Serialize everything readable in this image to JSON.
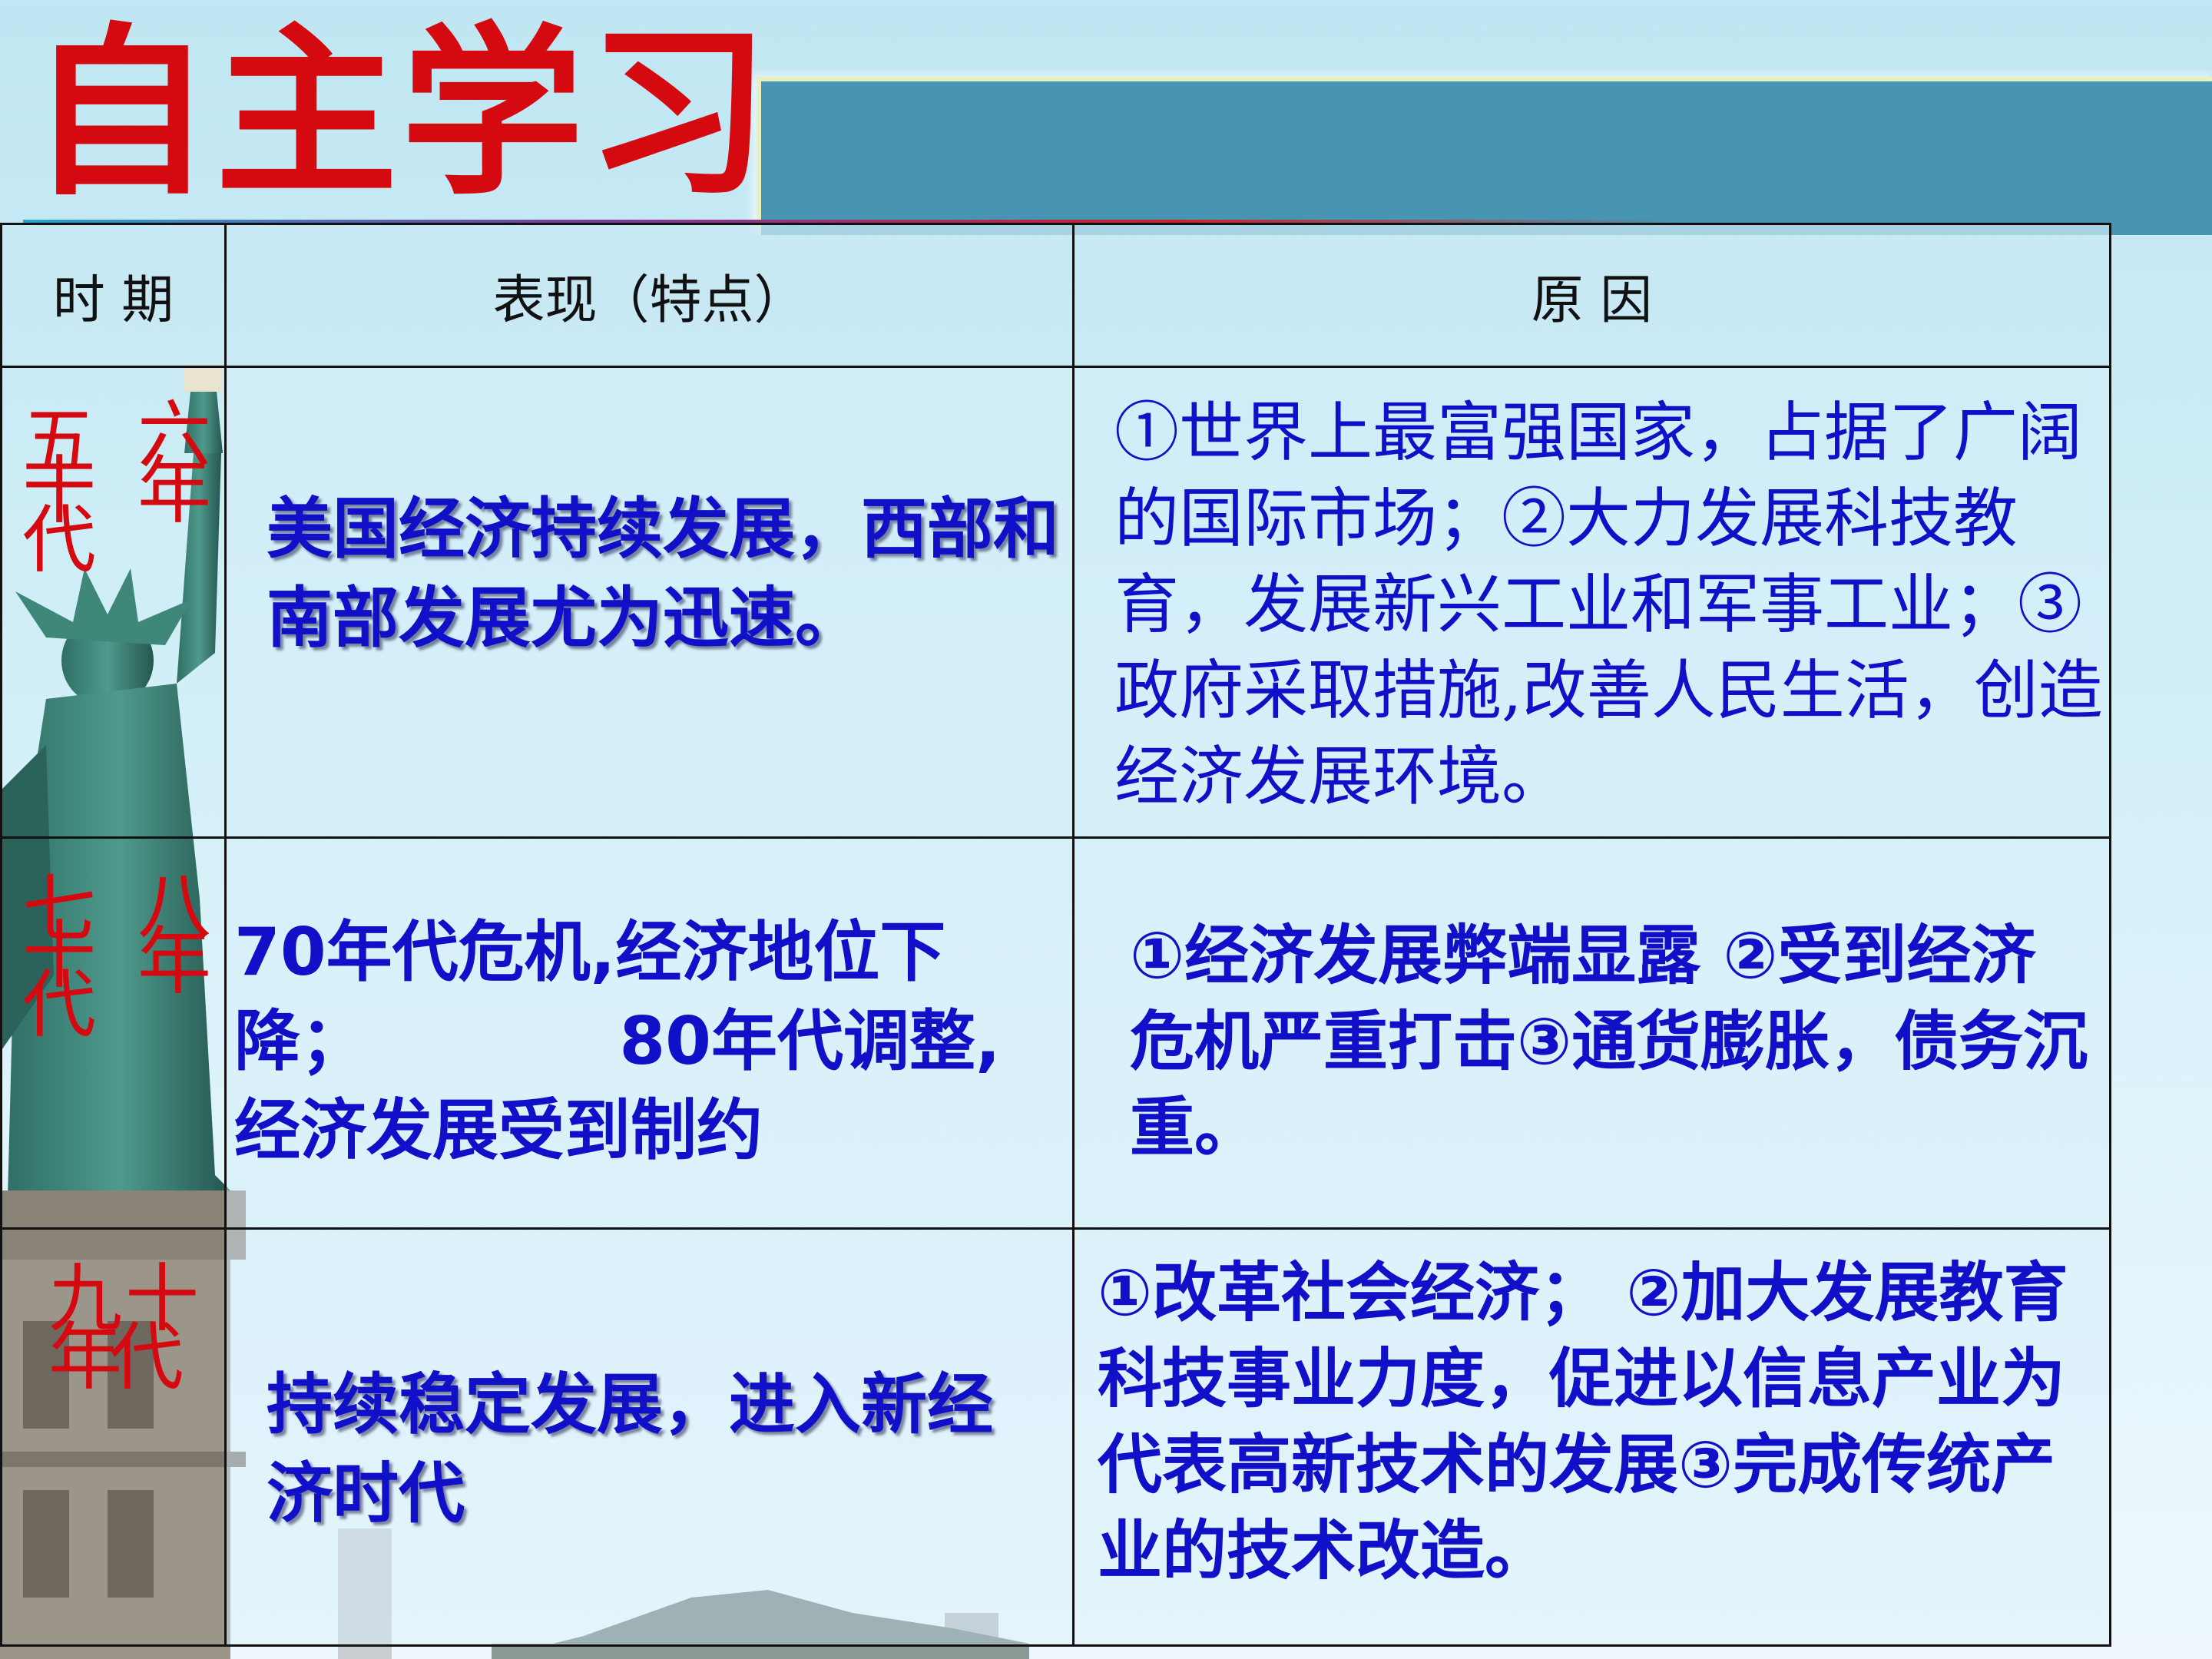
{
  "title": "自主学习",
  "table": {
    "headers": {
      "period": "时  期",
      "features": "表现（特点）",
      "reasons": "原      因"
    },
    "rows": [
      {
        "period_chars": [
          "五",
          "十",
          "代",
          "六",
          "年"
        ],
        "features": "美国经济持续发展，西部和南部发展尤为迅速。",
        "reasons": "①世界上最富强国家，占据了广阔的国际市场；②大力发展科技教育，发展新兴工业和军事工业；③政府采取措施,改善人民生活，创造经济发展环境。"
      },
      {
        "period_chars": [
          "七",
          "十",
          "代",
          "八",
          "年"
        ],
        "features_lines": [
          "70年代危机,经济地位下",
          "降；           80年代调整,",
          "经济发展受到制约"
        ],
        "reasons": "①经济发展弊端显露 ②受到经济危机严重打击③通货膨胀，债务沉重。"
      },
      {
        "period_chars": [
          "九",
          "十",
          "年",
          "代"
        ],
        "features": "持续稳定发展，进入新经济时代",
        "reasons": "①改革社会经济；  ②加大发展教育科技事业力度，促进以信息产业为代表高新技术的发展③完成传统产业的技术改造。"
      }
    ]
  }
}
